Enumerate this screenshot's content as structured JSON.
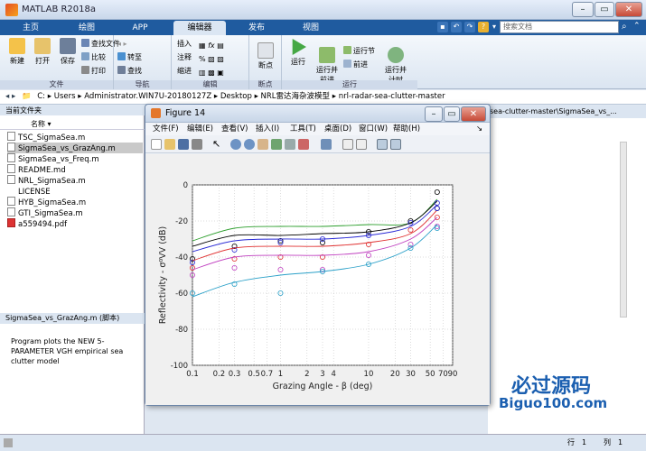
{
  "app": {
    "title": "MATLAB R2018a"
  },
  "search": {
    "placeholder": "搜索文档"
  },
  "ribbon_tabs": [
    "主页",
    "绘图",
    "APP",
    "编辑器",
    "发布",
    "视图"
  ],
  "ribbon": {
    "file": {
      "new": "新建",
      "open": "打开",
      "save": "保存",
      "find_files": "查找文件",
      "compare": "比较",
      "print": "打印",
      "group": "文件"
    },
    "navigate": {
      "goto": "转至",
      "find": "查找",
      "group": "导航"
    },
    "edit": {
      "insert": "插入",
      "comment": "注释",
      "indent": "缩进",
      "group": "编辑"
    },
    "breakpoints": {
      "label": "断点",
      "group": "断点"
    },
    "run": {
      "run": "运行",
      "run_advance": "运行并\n前进",
      "run_section": "运行节",
      "advance": "前进",
      "run_time": "运行并\n计时",
      "group": "运行"
    }
  },
  "address": {
    "segments": [
      "C:",
      "Users",
      "Administrator.WIN7U-20180127Z",
      "Desktop",
      "NRL雷达海杂波模型",
      "nrl-radar-sea-clutter-master"
    ]
  },
  "current_folder": {
    "header": "当前文件夹",
    "col_name": "名称",
    "files": [
      "TSC_SigmaSea.m",
      "SigmaSea_vs_GrazAng.m",
      "SigmaSea_vs_Freq.m",
      "README.md",
      "NRL_SigmaSea.m",
      "LICENSE",
      "HYB_SigmaSea.m",
      "GTI_SigmaSea.m",
      "a559494.pdf"
    ],
    "selected_index": 1
  },
  "details": {
    "header": "SigmaSea_vs_GrazAng.m  (脚本)",
    "text": "Program plots the NEW 5-PARAMETER VGH empirical sea clutter model"
  },
  "editor_path": "sea-clutter-master\\SigmaSea_vs_...",
  "status": {
    "row_label": "行",
    "row": "1",
    "col_label": "列",
    "col": "1"
  },
  "watermark": {
    "brand": "必过源码",
    "url": "Biguo100.com"
  },
  "figure": {
    "title": "Figure 14",
    "menu": [
      "文件(F)",
      "编辑(E)",
      "查看(V)",
      "插入(I)",
      "工具(T)",
      "桌面(D)",
      "窗口(W)",
      "帮助(H)"
    ]
  },
  "chart_data": {
    "type": "scatter",
    "xlabel": "Grazing Angle - β (deg)",
    "ylabel": "Reflectivity - σ⁰VV (dB)",
    "xscale": "log",
    "xlim": [
      0.1,
      90
    ],
    "ylim": [
      -100,
      0
    ],
    "xticks": [
      "0.1",
      "0.2",
      "0.3",
      "0.5",
      "0.7",
      "1",
      "2",
      "3",
      "4",
      "10",
      "20",
      "30",
      "50",
      "70",
      "90"
    ],
    "yticks": [
      "0",
      "-20",
      "-40",
      "-60",
      "-80",
      "-100"
    ],
    "grid": true,
    "x_points": [
      0.1,
      0.3,
      1,
      3,
      10,
      30,
      60
    ],
    "series": [
      {
        "color": "#2a9d2a",
        "line": [
          -31,
          -24,
          -23,
          -23,
          -22,
          -21,
          -8
        ],
        "points": []
      },
      {
        "color": "#000000",
        "line": [
          -34,
          -28,
          -28,
          -27,
          -26,
          -21,
          -9
        ],
        "points": [
          -41,
          -34,
          -31,
          -32,
          -26,
          -20,
          -4
        ]
      },
      {
        "color": "#2a2ad6",
        "line": [
          -37,
          -31,
          -30,
          -30,
          -28,
          -23,
          -11
        ],
        "points": [
          -43,
          -36,
          -32,
          -30,
          -28,
          -21,
          -10
        ]
      },
      {
        "color": "#e03030",
        "line": [
          -42,
          -35,
          -34,
          -34,
          -32,
          -27,
          -14
        ],
        "points": [
          -46,
          -41,
          -40,
          -40,
          -33,
          -25,
          -18
        ]
      },
      {
        "color": "#c040c0",
        "line": [
          -47,
          -40,
          -39,
          -39,
          -37,
          -30,
          -18
        ],
        "points": [
          -50,
          -46,
          -47,
          -47,
          -39,
          -33,
          -23
        ]
      },
      {
        "color": "#2aa0c8",
        "line": [
          -62,
          -54,
          -50,
          -48,
          -44,
          -35,
          -22
        ],
        "points": [
          -60,
          -55,
          -60,
          -48,
          -44,
          -35,
          -24
        ]
      }
    ],
    "extra_points": [
      {
        "color": "#000000",
        "x": 60,
        "y": -13
      },
      {
        "color": "#2a2ad6",
        "x": 60,
        "y": -13
      }
    ]
  }
}
